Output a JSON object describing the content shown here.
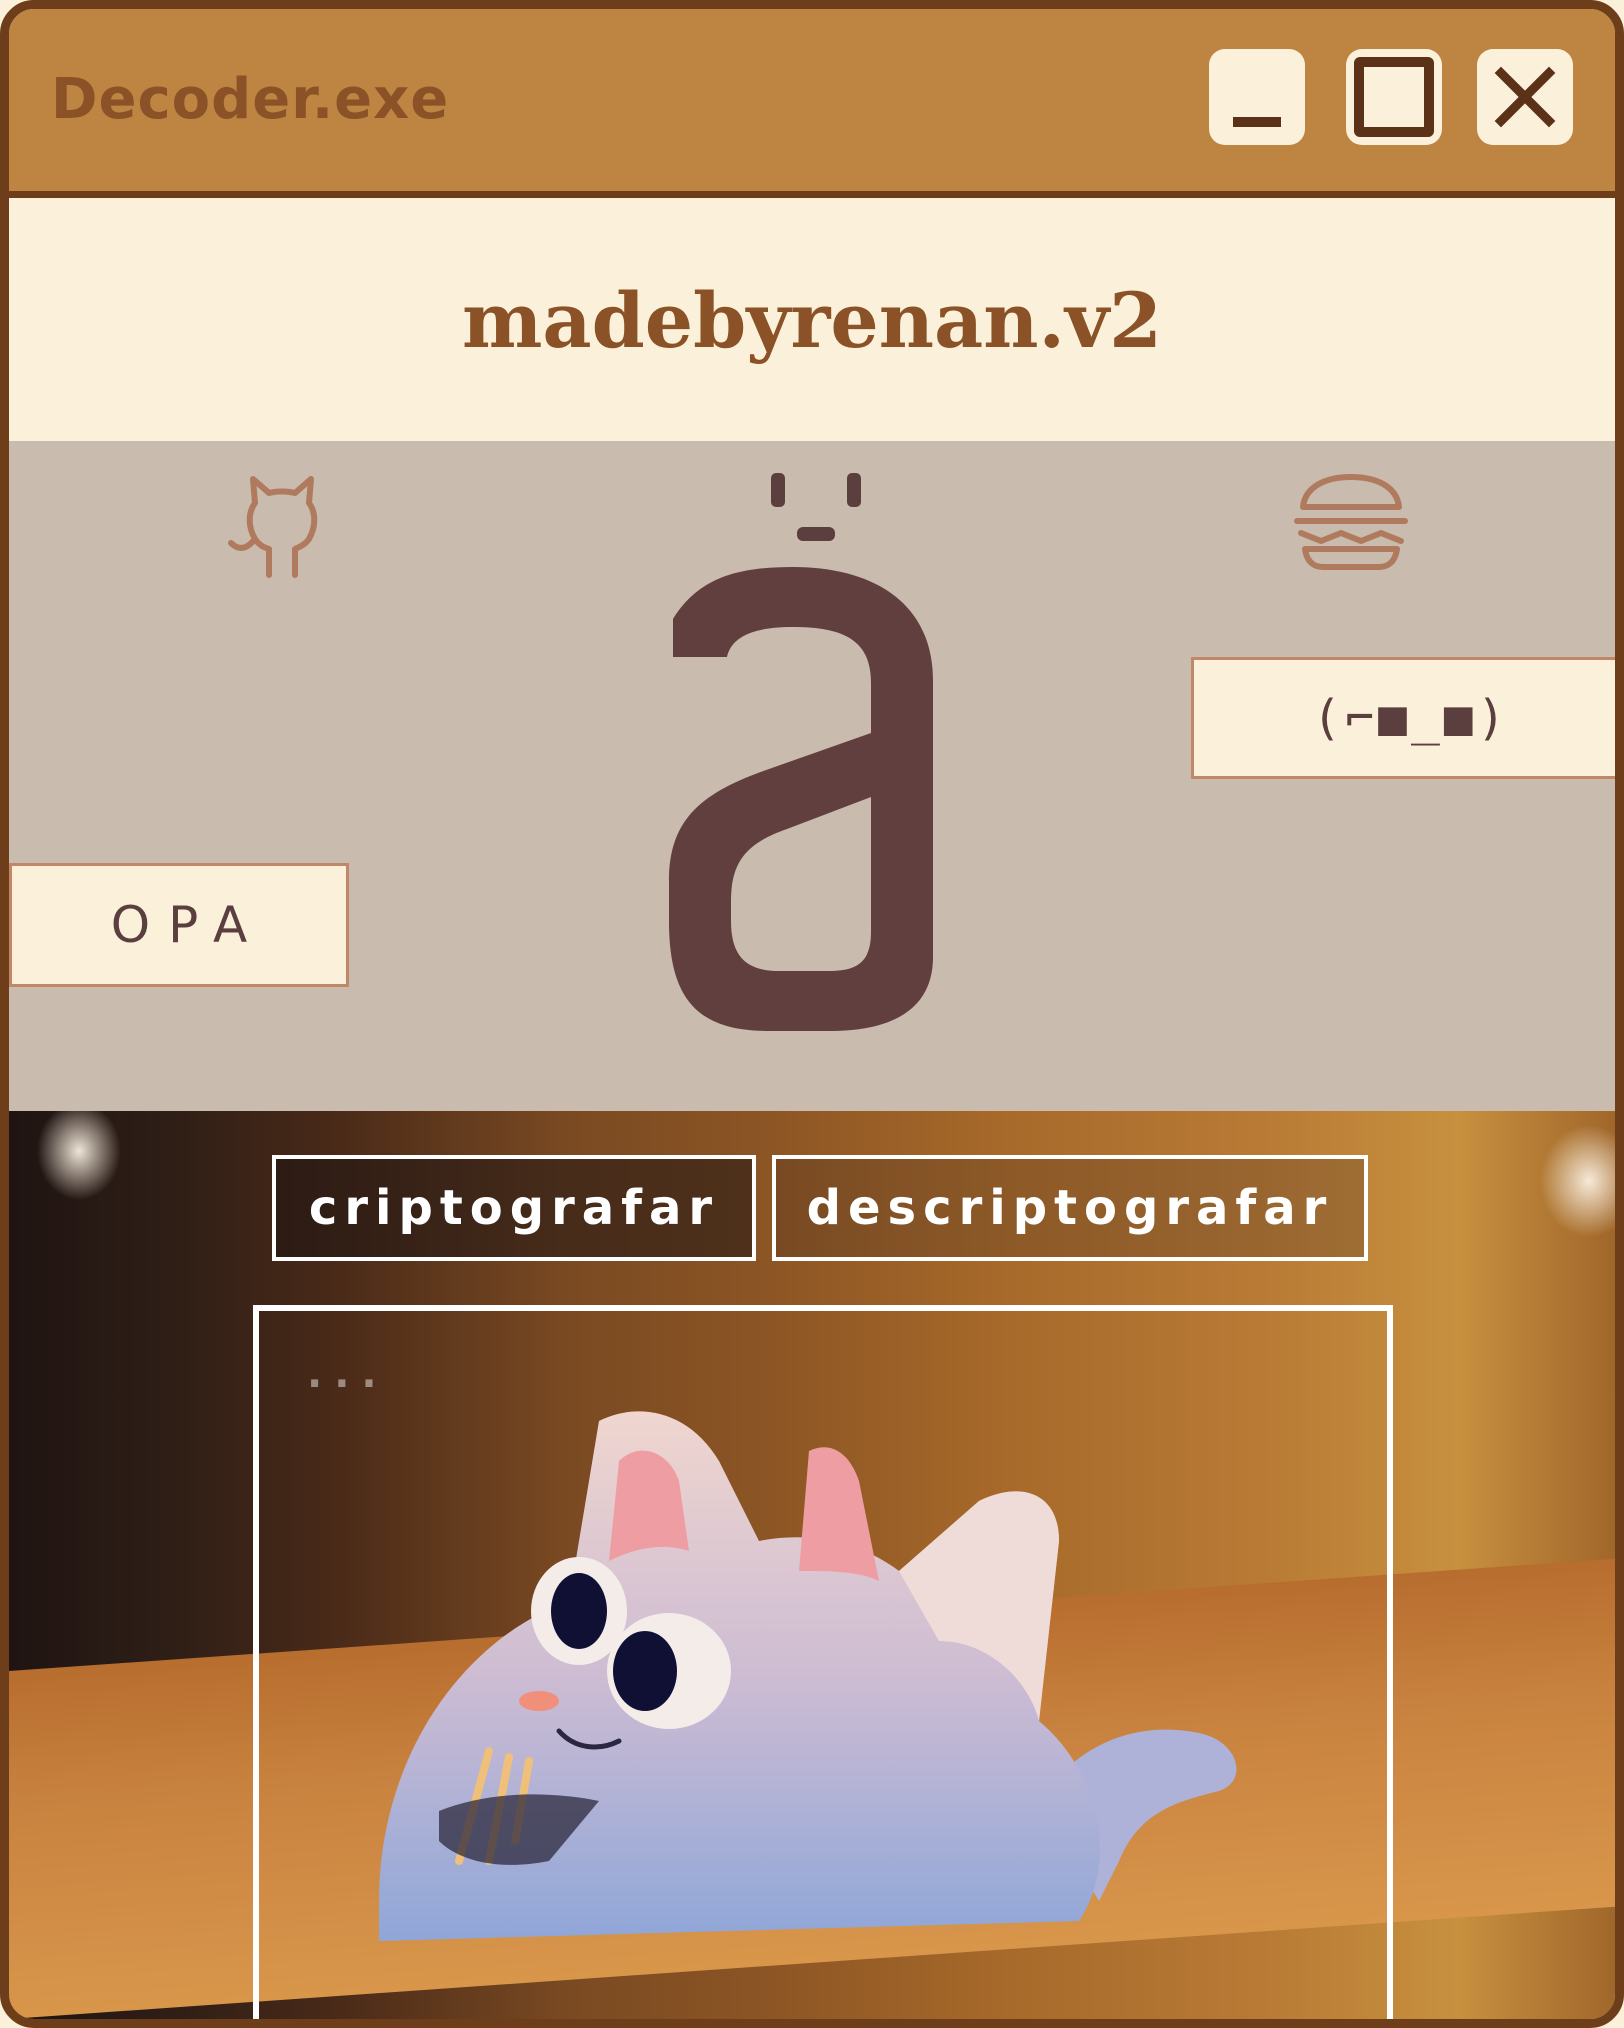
{
  "window": {
    "title": "Decoder.exe",
    "controls": {
      "minimize": "minimize-icon",
      "maximize": "maximize-icon",
      "close": "close-icon"
    }
  },
  "header": {
    "brand": "madebyrenan.v2"
  },
  "stage": {
    "icons": [
      "github-cat-icon",
      "face-icon",
      "burger-icon"
    ],
    "letter": "a",
    "kaomoji": "(⌐■_■)",
    "button_label": "OPA"
  },
  "actions": {
    "encrypt_label": "criptografar",
    "decrypt_label": "descriptografar"
  },
  "editor": {
    "placeholder": "..."
  },
  "colors": {
    "titlebar": "#bd8442",
    "border": "#6e3e1a",
    "cream": "#fbf0da",
    "stage": "#c9bbad",
    "brand_text": "#8a5226",
    "letter": "#613f3f",
    "icon_stroke": "#b07a5e"
  }
}
